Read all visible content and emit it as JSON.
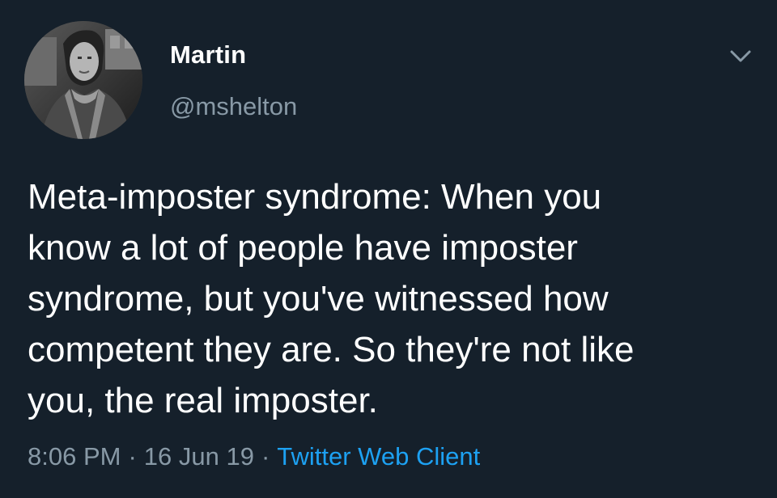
{
  "tweet": {
    "author": {
      "display_name": "Martin",
      "handle": "@mshelton"
    },
    "text": "Meta-imposter syndrome: When you\nknow a lot of people have imposter\nsyndrome, but you've witnessed how\ncompetent they are. So they're not like\nyou, the real imposter.",
    "time": "8:06 PM",
    "date": "16 Jun 19",
    "separator": "·",
    "client": "Twitter Web Client",
    "menu_icon": "chevron-down-icon",
    "avatar_icon": "avatar-photo"
  },
  "colors": {
    "background": "#15202b",
    "text_primary": "#ffffff",
    "text_secondary": "#8899a6",
    "accent": "#1da1f2"
  }
}
